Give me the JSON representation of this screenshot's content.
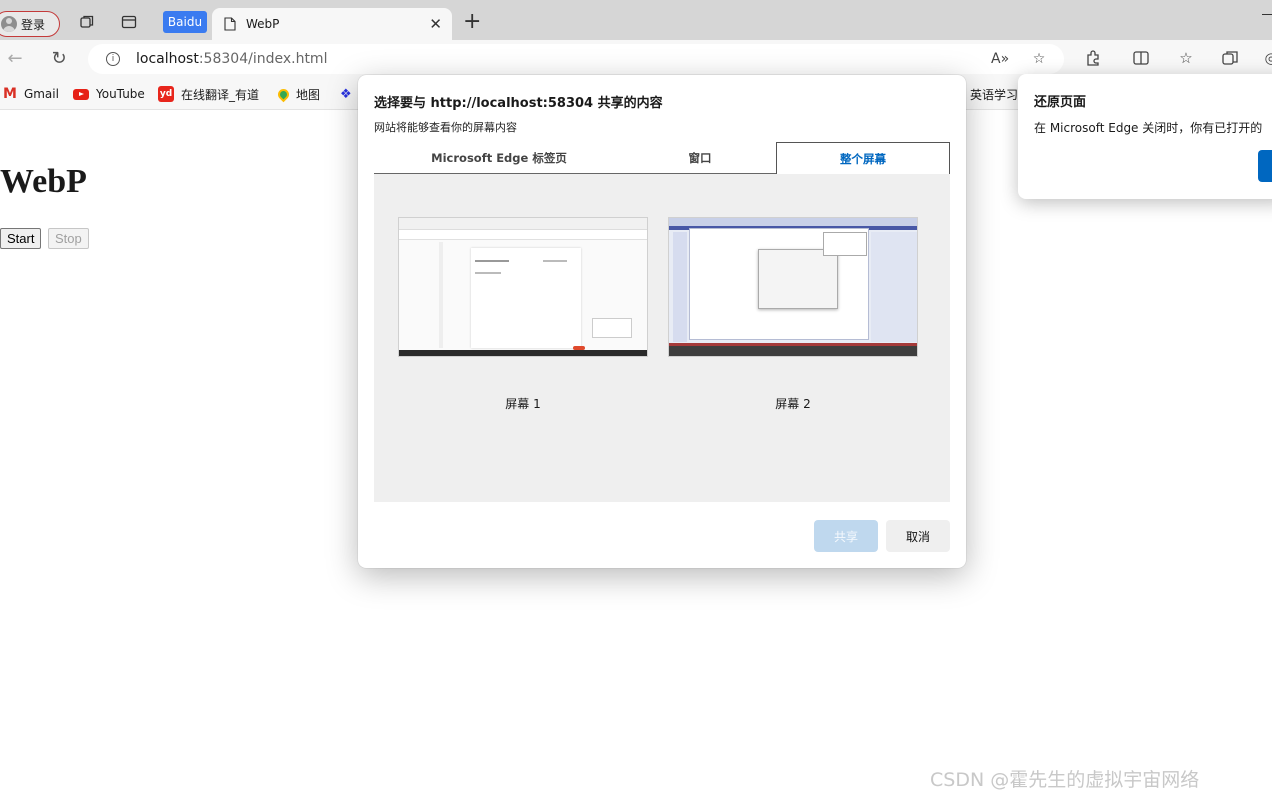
{
  "browser": {
    "profile_label": "登录",
    "baidu_tab_label": "Baidu",
    "active_tab_title": "WebP",
    "address": {
      "host": "localhost",
      "path": ":58304/index.html"
    }
  },
  "bookmarks": [
    {
      "label": "Gmail",
      "icon": "gmail-icon"
    },
    {
      "label": "YouTube",
      "icon": "youtube-icon"
    },
    {
      "label": "在线翻译_有道",
      "icon": "youdao-icon"
    },
    {
      "label": "地图",
      "icon": "maps-pin-icon"
    },
    {
      "label": "",
      "icon": "baidu-paw-icon"
    },
    {
      "label": "英语学习",
      "icon": ""
    }
  ],
  "page": {
    "title": "WebP",
    "start_label": "Start",
    "stop_label": "Stop"
  },
  "share_dialog": {
    "title": "选择要与 http://localhost:58304 共享的内容",
    "subtitle": "网站将能够查看你的屏幕内容",
    "tabs": [
      "Microsoft Edge 标签页",
      "窗口",
      "整个屏幕"
    ],
    "selected_tab": "整个屏幕",
    "screens": [
      "屏幕 1",
      "屏幕 2"
    ],
    "share_label": "共享",
    "cancel_label": "取消"
  },
  "restore_popup": {
    "title": "还原页面",
    "text": "在 Microsoft Edge 关闭时，你有已打开的"
  },
  "watermark": "CSDN @霍先生的虚拟宇宙网络",
  "colors": {
    "accent": "#0067c0",
    "share_disabled_bg": "#bfd8ee",
    "profile_border": "#c43a3a"
  }
}
